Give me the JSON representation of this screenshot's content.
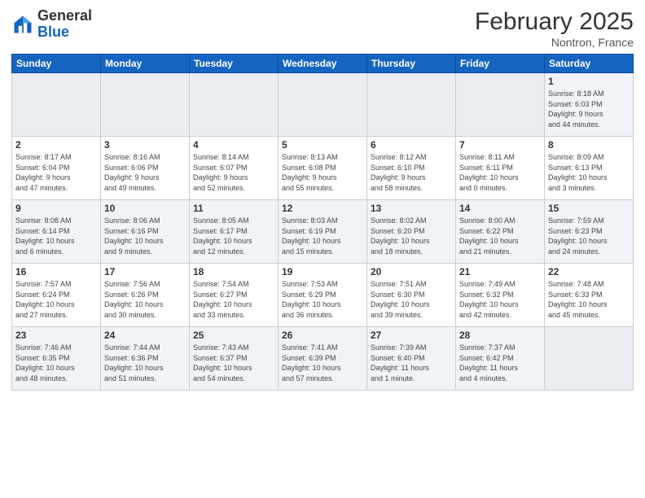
{
  "logo": {
    "text_general": "General",
    "text_blue": "Blue"
  },
  "header": {
    "month_year": "February 2025",
    "location": "Nontron, France"
  },
  "weekdays": [
    "Sunday",
    "Monday",
    "Tuesday",
    "Wednesday",
    "Thursday",
    "Friday",
    "Saturday"
  ],
  "weeks": [
    [
      {
        "day": "",
        "info": ""
      },
      {
        "day": "",
        "info": ""
      },
      {
        "day": "",
        "info": ""
      },
      {
        "day": "",
        "info": ""
      },
      {
        "day": "",
        "info": ""
      },
      {
        "day": "",
        "info": ""
      },
      {
        "day": "1",
        "info": "Sunrise: 8:18 AM\nSunset: 6:03 PM\nDaylight: 9 hours\nand 44 minutes."
      }
    ],
    [
      {
        "day": "2",
        "info": "Sunrise: 8:17 AM\nSunset: 6:04 PM\nDaylight: 9 hours\nand 47 minutes."
      },
      {
        "day": "3",
        "info": "Sunrise: 8:16 AM\nSunset: 6:06 PM\nDaylight: 9 hours\nand 49 minutes."
      },
      {
        "day": "4",
        "info": "Sunrise: 8:14 AM\nSunset: 6:07 PM\nDaylight: 9 hours\nand 52 minutes."
      },
      {
        "day": "5",
        "info": "Sunrise: 8:13 AM\nSunset: 6:08 PM\nDaylight: 9 hours\nand 55 minutes."
      },
      {
        "day": "6",
        "info": "Sunrise: 8:12 AM\nSunset: 6:10 PM\nDaylight: 9 hours\nand 58 minutes."
      },
      {
        "day": "7",
        "info": "Sunrise: 8:11 AM\nSunset: 6:11 PM\nDaylight: 10 hours\nand 0 minutes."
      },
      {
        "day": "8",
        "info": "Sunrise: 8:09 AM\nSunset: 6:13 PM\nDaylight: 10 hours\nand 3 minutes."
      }
    ],
    [
      {
        "day": "9",
        "info": "Sunrise: 8:08 AM\nSunset: 6:14 PM\nDaylight: 10 hours\nand 6 minutes."
      },
      {
        "day": "10",
        "info": "Sunrise: 8:06 AM\nSunset: 6:16 PM\nDaylight: 10 hours\nand 9 minutes."
      },
      {
        "day": "11",
        "info": "Sunrise: 8:05 AM\nSunset: 6:17 PM\nDaylight: 10 hours\nand 12 minutes."
      },
      {
        "day": "12",
        "info": "Sunrise: 8:03 AM\nSunset: 6:19 PM\nDaylight: 10 hours\nand 15 minutes."
      },
      {
        "day": "13",
        "info": "Sunrise: 8:02 AM\nSunset: 6:20 PM\nDaylight: 10 hours\nand 18 minutes."
      },
      {
        "day": "14",
        "info": "Sunrise: 8:00 AM\nSunset: 6:22 PM\nDaylight: 10 hours\nand 21 minutes."
      },
      {
        "day": "15",
        "info": "Sunrise: 7:59 AM\nSunset: 6:23 PM\nDaylight: 10 hours\nand 24 minutes."
      }
    ],
    [
      {
        "day": "16",
        "info": "Sunrise: 7:57 AM\nSunset: 6:24 PM\nDaylight: 10 hours\nand 27 minutes."
      },
      {
        "day": "17",
        "info": "Sunrise: 7:56 AM\nSunset: 6:26 PM\nDaylight: 10 hours\nand 30 minutes."
      },
      {
        "day": "18",
        "info": "Sunrise: 7:54 AM\nSunset: 6:27 PM\nDaylight: 10 hours\nand 33 minutes."
      },
      {
        "day": "19",
        "info": "Sunrise: 7:53 AM\nSunset: 6:29 PM\nDaylight: 10 hours\nand 36 minutes."
      },
      {
        "day": "20",
        "info": "Sunrise: 7:51 AM\nSunset: 6:30 PM\nDaylight: 10 hours\nand 39 minutes."
      },
      {
        "day": "21",
        "info": "Sunrise: 7:49 AM\nSunset: 6:32 PM\nDaylight: 10 hours\nand 42 minutes."
      },
      {
        "day": "22",
        "info": "Sunrise: 7:48 AM\nSunset: 6:33 PM\nDaylight: 10 hours\nand 45 minutes."
      }
    ],
    [
      {
        "day": "23",
        "info": "Sunrise: 7:46 AM\nSunset: 6:35 PM\nDaylight: 10 hours\nand 48 minutes."
      },
      {
        "day": "24",
        "info": "Sunrise: 7:44 AM\nSunset: 6:36 PM\nDaylight: 10 hours\nand 51 minutes."
      },
      {
        "day": "25",
        "info": "Sunrise: 7:43 AM\nSunset: 6:37 PM\nDaylight: 10 hours\nand 54 minutes."
      },
      {
        "day": "26",
        "info": "Sunrise: 7:41 AM\nSunset: 6:39 PM\nDaylight: 10 hours\nand 57 minutes."
      },
      {
        "day": "27",
        "info": "Sunrise: 7:39 AM\nSunset: 6:40 PM\nDaylight: 11 hours\nand 1 minute."
      },
      {
        "day": "28",
        "info": "Sunrise: 7:37 AM\nSunset: 6:42 PM\nDaylight: 11 hours\nand 4 minutes."
      },
      {
        "day": "",
        "info": ""
      }
    ]
  ]
}
